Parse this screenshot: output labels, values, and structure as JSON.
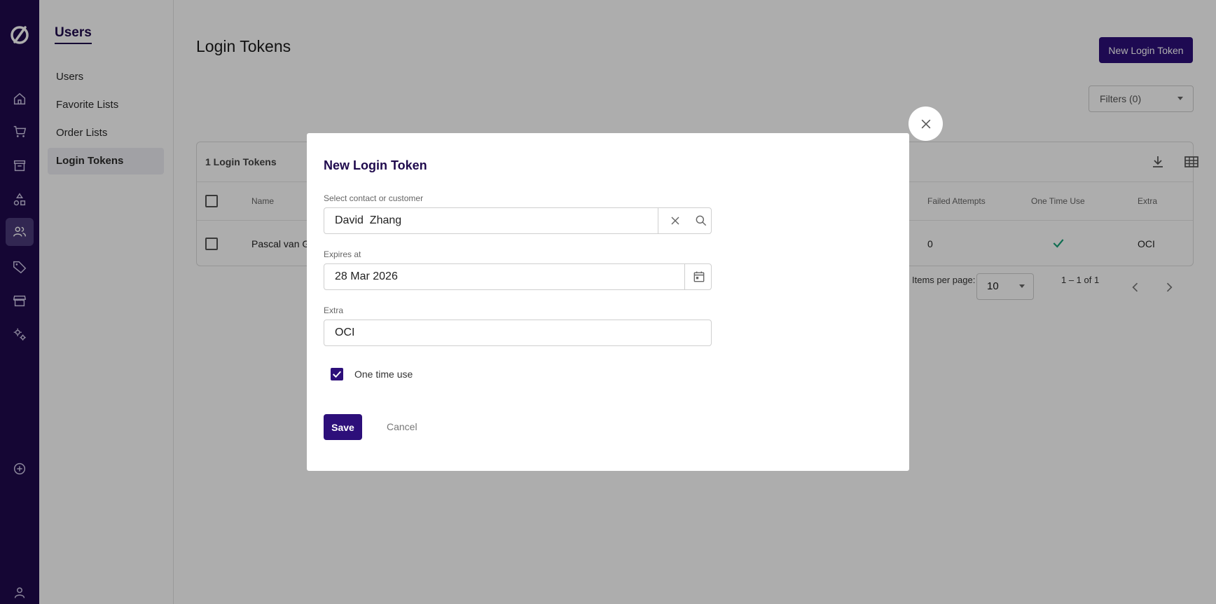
{
  "subnav": {
    "title": "Users",
    "items": [
      "Users",
      "Favorite Lists",
      "Order Lists",
      "Login Tokens"
    ]
  },
  "page": {
    "title": "Login Tokens",
    "new_button": "New Login Token",
    "filters": "Filters (0)"
  },
  "table": {
    "count_label": "1 Login Tokens",
    "headers": {
      "name": "Name",
      "failed": "Failed Attempts",
      "one_time": "One Time Use",
      "extra": "Extra"
    },
    "row": {
      "name": "Pascal van G",
      "failed": "0",
      "extra": "OCI"
    }
  },
  "pager": {
    "items_per_page_label": "Items per page:",
    "per_page_value": "10",
    "range": "1 – 1 of 1"
  },
  "modal": {
    "title": "New Login Token",
    "contact_label": "Select contact or customer",
    "contact_value": "David  Zhang",
    "expires_label": "Expires at",
    "expires_value": "28 Mar 2026",
    "extra_label": "Extra",
    "extra_value": "OCI",
    "one_time_label": "One time use",
    "one_time_checked": true,
    "save": "Save",
    "cancel": "Cancel"
  },
  "colors": {
    "rail": "#1f0a4d",
    "primary": "#2d0f7a",
    "success": "#1aa37a"
  }
}
